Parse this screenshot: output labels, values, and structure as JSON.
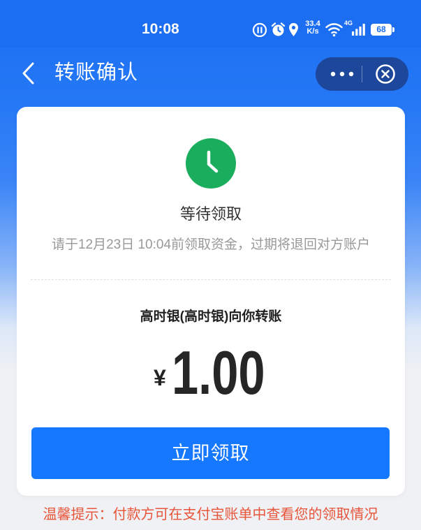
{
  "status_bar": {
    "time": "10:08",
    "net_speed_value": "33.4",
    "net_speed_unit": "K/s",
    "network": "4G",
    "battery": "68",
    "icons": [
      "data-saver-icon",
      "alarm-icon",
      "location-icon",
      "wifi-icon",
      "signal-icon",
      "battery-icon"
    ]
  },
  "header": {
    "title": "转账确认",
    "icons": {
      "back": "chevron-left-icon",
      "more": "more-icon",
      "close": "close-circle-icon"
    }
  },
  "transfer": {
    "status_icon": "clock-icon",
    "status": "等待领取",
    "deadline_note": "请于12月23日 10:04前领取资金，过期将退回对方账户",
    "sender_line": "高时银(高时银)向你转账",
    "currency": "¥",
    "amount": "1.00",
    "claim_label": "立即领取"
  },
  "tip": "温馨提示：付款方可在支付宝账单中查看您的领取情况",
  "colors": {
    "primary": "#1677ff",
    "success": "#1aad5e",
    "tip_text": "#e8553a",
    "header_bg": "#1b6df1"
  }
}
